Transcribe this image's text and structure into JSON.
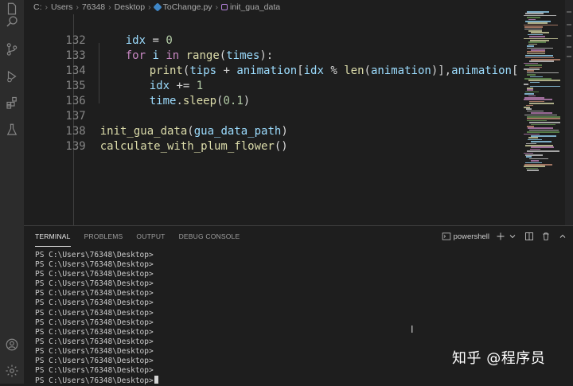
{
  "breadcrumb": {
    "items": [
      "C:",
      "Users",
      "76348",
      "Desktop",
      "ToChange.py",
      "init_gua_data"
    ]
  },
  "editor": {
    "lines": [
      {
        "num": "132",
        "text": "idx = 0"
      },
      {
        "num": "133",
        "text": "for i in range(times):"
      },
      {
        "num": "134",
        "text": "print(tips + animation[idx % len(animation)],animation[idx % len"
      },
      {
        "num": "135",
        "text": "idx += 1"
      },
      {
        "num": "136",
        "text": "time.sleep(0.1)"
      },
      {
        "num": "137",
        "text": ""
      },
      {
        "num": "138",
        "text": "init_gua_data(gua_data_path)"
      },
      {
        "num": "139",
        "text": "calculate_with_plum_flower()"
      }
    ]
  },
  "panel": {
    "tabs": [
      "TERMINAL",
      "PROBLEMS",
      "OUTPUT",
      "DEBUG CONSOLE"
    ],
    "active_tab": "TERMINAL",
    "shell_label": "powershell",
    "prompt": "PS C:\\Users\\76348\\Desktop>",
    "prompt_count": 14
  },
  "watermark": "知乎 @程序员",
  "icons": {
    "activity": [
      "files-icon",
      "search-icon",
      "source-control-icon",
      "run-debug-icon",
      "extensions-icon",
      "testing-icon",
      "account-icon",
      "settings-gear-icon"
    ]
  },
  "colors": {
    "background": "#1e1e1e",
    "keyword": "#c586c0",
    "function": "#dcdcaa",
    "variable": "#9cdcfe",
    "number": "#b5cea8"
  }
}
